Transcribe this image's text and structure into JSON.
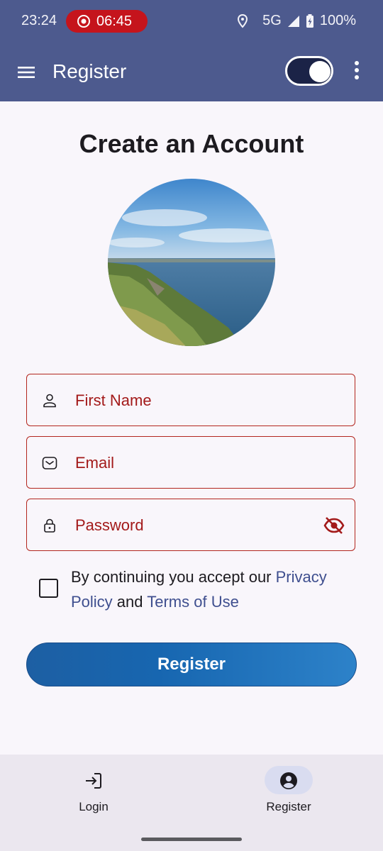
{
  "status_bar": {
    "time": "23:24",
    "recording_timer": "06:45",
    "network": "5G",
    "battery": "100%",
    "colors": {
      "bar": "#4d5a8e",
      "recording": "#c5141c"
    }
  },
  "app_bar": {
    "title": "Register",
    "icons": [
      "menu-icon",
      "theme-toggle",
      "more-vert-icon"
    ]
  },
  "main": {
    "heading": "Create an Account",
    "avatar_description": "profile-photo",
    "fields": [
      {
        "label": "First Name",
        "icon": "person-icon"
      },
      {
        "label": "Email",
        "icon": "mail-icon"
      },
      {
        "label": "Password",
        "icon": "lock-icon",
        "trailing_icon": "visibility-off-icon"
      }
    ],
    "consent": {
      "prefix": "By continuing you accept our ",
      "privacy_link": "Privacy Policy",
      "middle": " and ",
      "terms_link": "Terms of Use",
      "checked": false
    },
    "register_button": "Register",
    "colors": {
      "error": "#b3261e",
      "link": "#3f4f8f",
      "button": "#1766b0"
    }
  },
  "bottom_nav": {
    "items": [
      {
        "label": "Login",
        "icon": "login-icon",
        "selected": false
      },
      {
        "label": "Register",
        "icon": "account-circle-icon",
        "selected": true
      }
    ]
  }
}
